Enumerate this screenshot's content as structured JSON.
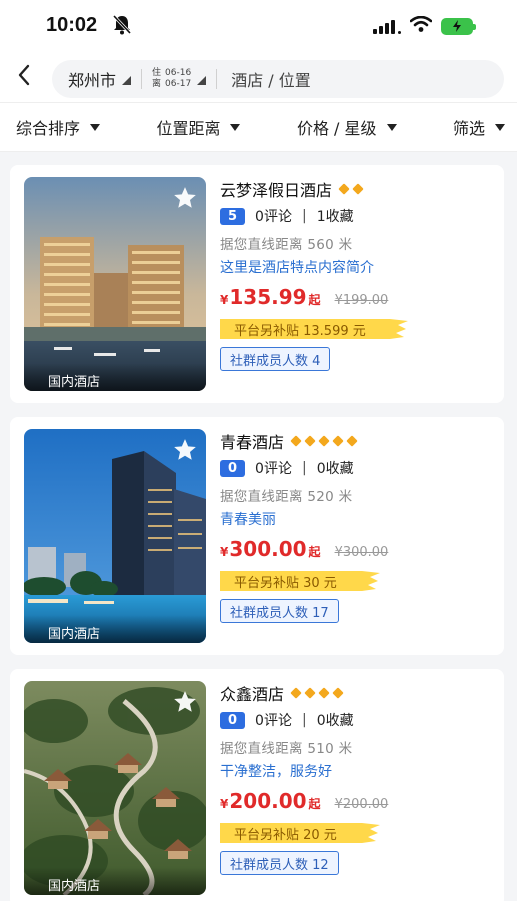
{
  "status_bar": {
    "time": "10:02"
  },
  "search": {
    "city": "郑州市",
    "checkin_label": "住",
    "checkin_date": "06-16",
    "checkout_label": "离",
    "checkout_date": "06-17",
    "placeholder": "酒店 / 位置"
  },
  "filters": [
    {
      "label": "综合排序"
    },
    {
      "label": "位置距离"
    },
    {
      "label": "价格 / 星级"
    },
    {
      "label": "筛选"
    }
  ],
  "hotels": [
    {
      "name": "云梦泽假日酒店",
      "star_count": 2,
      "score": "5",
      "reviews": "0评论",
      "favorites": "1收藏",
      "distance": "据您直线距离 560 米",
      "description": "这里是酒店特点内容简介",
      "currency": "¥",
      "price": "135.99",
      "price_suffix": "起",
      "original_price": "¥199.00",
      "subsidy": "平台另补贴 13.599 元",
      "members": "社群成员人数 4",
      "tag": "国内酒店"
    },
    {
      "name": "青春酒店",
      "star_count": 5,
      "score": "0",
      "reviews": "0评论",
      "favorites": "0收藏",
      "distance": "据您直线距离 520 米",
      "description": "青春美丽",
      "currency": "¥",
      "price": "300.00",
      "price_suffix": "起",
      "original_price": "¥300.00",
      "subsidy": "平台另补贴 30 元",
      "members": "社群成员人数 17",
      "tag": "国内酒店"
    },
    {
      "name": "众鑫酒店",
      "star_count": 4,
      "score": "0",
      "reviews": "0评论",
      "favorites": "0收藏",
      "distance": "据您直线距离 510 米",
      "description": "干净整洁，服务好",
      "currency": "¥",
      "price": "200.00",
      "price_suffix": "起",
      "original_price": "¥200.00",
      "subsidy": "平台另补贴 20 元",
      "members": "社群成员人数 12",
      "tag": "国内酒店"
    }
  ],
  "icons": {
    "back": "chevron-left-icon",
    "favorite": "star-icon",
    "mute": "bell-slash-icon",
    "signal": "signal-icon",
    "wifi": "wifi-icon",
    "battery": "battery-charging-icon",
    "rating": "diamond-icon"
  },
  "colors": {
    "price": "#e02a2a",
    "score_badge": "#2d6de0",
    "description": "#2a6fd0",
    "rating": "#f3a81d",
    "subsidy_bg": "#ffd84a",
    "battery": "#3bc24a"
  }
}
